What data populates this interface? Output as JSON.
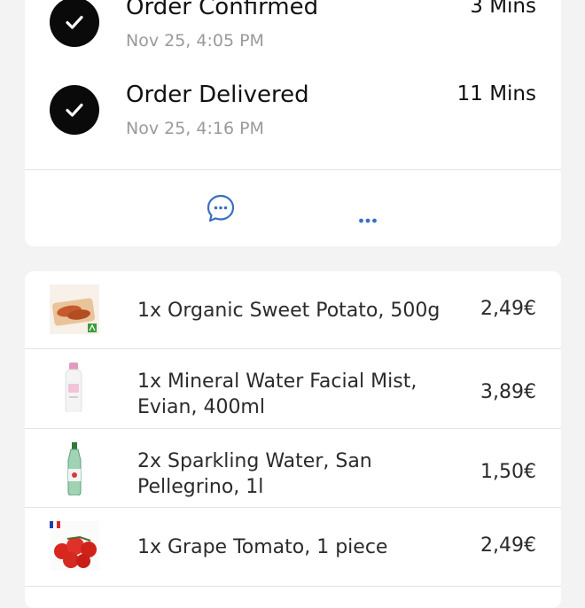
{
  "tracking": {
    "steps": [
      {
        "title": "Order Confirmed",
        "time": "Nov 25, 4:05 PM",
        "duration": "3 Mins"
      },
      {
        "title": "Order Delivered",
        "time": "Nov 25, 4:16 PM",
        "duration": "11 Mins"
      }
    ],
    "actions": {
      "chat_icon": "chat-bubble-icon",
      "more_icon": "more-dots-icon"
    }
  },
  "items": [
    {
      "name": "1x Organic Sweet Potato, 500g",
      "price": "2,49€"
    },
    {
      "name": "1x Mineral Water Facial Mist, Evian, 400ml",
      "price": "3,89€"
    },
    {
      "name": "2x Sparkling Water, San Pellegrino, 1l",
      "price": "1,50€"
    },
    {
      "name": "1x Grape Tomato, 1 piece",
      "price": "2,49€"
    }
  ],
  "colors": {
    "accent": "#3a6fc4",
    "check_bg": "#0a0a0a",
    "muted_text": "#9a9a9a"
  }
}
